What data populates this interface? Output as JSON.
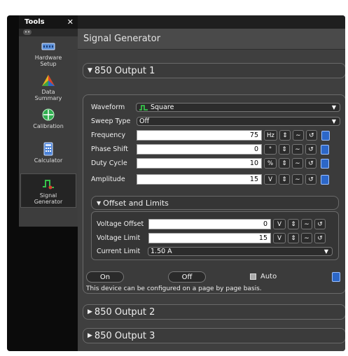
{
  "tools": {
    "title": "Tools",
    "close": "✕",
    "items": [
      {
        "label": "Hardware\nSetup",
        "icon": "hardware-setup-icon"
      },
      {
        "label": "Data\nSummary",
        "icon": "data-summary-icon"
      },
      {
        "label": "Calibration",
        "icon": "calibration-icon"
      },
      {
        "label": "Calculator",
        "icon": "calculator-icon"
      },
      {
        "label": "Signal\nGenerator",
        "icon": "signal-generator-icon"
      }
    ]
  },
  "page": {
    "title": "Signal Generator"
  },
  "output1": {
    "header": "850 Output 1",
    "waveform": {
      "label": "Waveform",
      "value": "Square"
    },
    "sweep": {
      "label": "Sweep Type",
      "value": "Off"
    },
    "frequency": {
      "label": "Frequency",
      "value": "75",
      "unit": "Hz"
    },
    "phase": {
      "label": "Phase Shift",
      "value": "0",
      "unit": "°"
    },
    "duty": {
      "label": "Duty Cycle",
      "value": "10",
      "unit": "%"
    },
    "amplitude": {
      "label": "Amplitude",
      "value": "15",
      "unit": "V"
    },
    "limits": {
      "header": "Offset and Limits",
      "offset": {
        "label": "Voltage Offset",
        "value": "0",
        "unit": "V"
      },
      "vlimit": {
        "label": "Voltage Limit",
        "value": "15",
        "unit": "V"
      },
      "climit": {
        "label": "Current Limit",
        "value": "1.50 A"
      }
    },
    "on_label": "On",
    "off_label": "Off",
    "auto_label": "Auto",
    "note": "This device can be configured on a page by page basis."
  },
  "output2": {
    "header": "850 Output 2"
  },
  "output3": {
    "header": "850 Output 3"
  },
  "colors": {
    "accent": "#2c67c8",
    "background": "#3f3f3f",
    "waveform_icon": "#36c24a"
  }
}
